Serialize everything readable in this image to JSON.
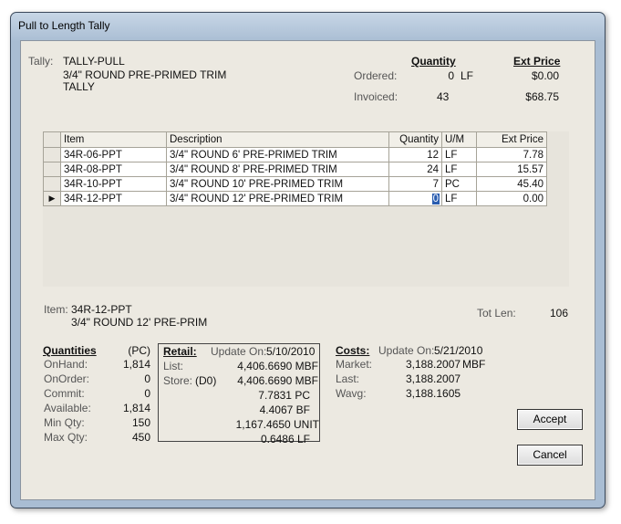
{
  "window": {
    "title": "Pull to Length Tally"
  },
  "tally": {
    "label": "Tally:",
    "code": "TALLY-PULL",
    "description": "3/4\" ROUND PRE-PRIMED TRIM",
    "type": "TALLY"
  },
  "summary": {
    "quantity_header": "Quantity",
    "ext_price_header": "Ext Price",
    "ordered_label": "Ordered:",
    "ordered_qty": "0",
    "ordered_uom": "LF",
    "ordered_price": "$0.00",
    "invoiced_label": "Invoiced:",
    "invoiced_qty": "43",
    "invoiced_price": "$68.75"
  },
  "grid": {
    "columns": [
      "Item",
      "Description",
      "Quantity",
      "U/M",
      "Ext Price"
    ],
    "rows": [
      {
        "item": "34R-06-PPT",
        "description": "3/4\" ROUND 6' PRE-PRIMED TRIM",
        "quantity": "12",
        "uom": "LF",
        "ext_price": "7.78"
      },
      {
        "item": "34R-08-PPT",
        "description": "3/4\" ROUND 8' PRE-PRIMED TRIM",
        "quantity": "24",
        "uom": "LF",
        "ext_price": "15.57"
      },
      {
        "item": "34R-10-PPT",
        "description": "3/4\" ROUND 10' PRE-PRIMED TRIM",
        "quantity": "7",
        "uom": "PC",
        "ext_price": "45.40"
      },
      {
        "item": "34R-12-PPT",
        "description": "3/4\" ROUND 12' PRE-PRIMED TRIM",
        "quantity": "0",
        "uom": "LF",
        "ext_price": "0.00"
      }
    ],
    "current_row_marker": "▶"
  },
  "item_info": {
    "label": "Item:",
    "code": "34R-12-PPT",
    "description": "3/4\" ROUND 12' PRE-PRIM",
    "tot_len_label": "Tot Len:",
    "tot_len": "106"
  },
  "quantities": {
    "header": "Quantities",
    "unit": "(PC)",
    "rows": [
      {
        "label": "OnHand:",
        "value": "1,814"
      },
      {
        "label": "OnOrder:",
        "value": "0"
      },
      {
        "label": "Commit:",
        "value": "0"
      },
      {
        "label": "Available:",
        "value": "1,814"
      },
      {
        "label": "Min Qty:",
        "value": "150"
      },
      {
        "label": "Max Qty:",
        "value": "450"
      }
    ]
  },
  "retail": {
    "header": "Retail:",
    "update_label": "Update On:",
    "update_date": "5/10/2010",
    "list_label": "List:",
    "store_label": "Store:",
    "store_code": "(D0)",
    "values": [
      "4,406.6690 MBF",
      "4,406.6690 MBF",
      "7.7831 PC",
      "4.4067 BF",
      "1,167.4650 UNIT",
      "0.6486 LF"
    ]
  },
  "costs": {
    "header": "Costs:",
    "update_label": "Update On:",
    "update_date": "5/21/2010",
    "rows": [
      {
        "label": "Market:",
        "value": "3,188.2007",
        "unit": "MBF"
      },
      {
        "label": "Last:",
        "value": "3,188.2007",
        "unit": ""
      },
      {
        "label": "Wavg:",
        "value": "3,188.1605",
        "unit": ""
      }
    ]
  },
  "buttons": {
    "accept": "Accept",
    "cancel": "Cancel"
  }
}
